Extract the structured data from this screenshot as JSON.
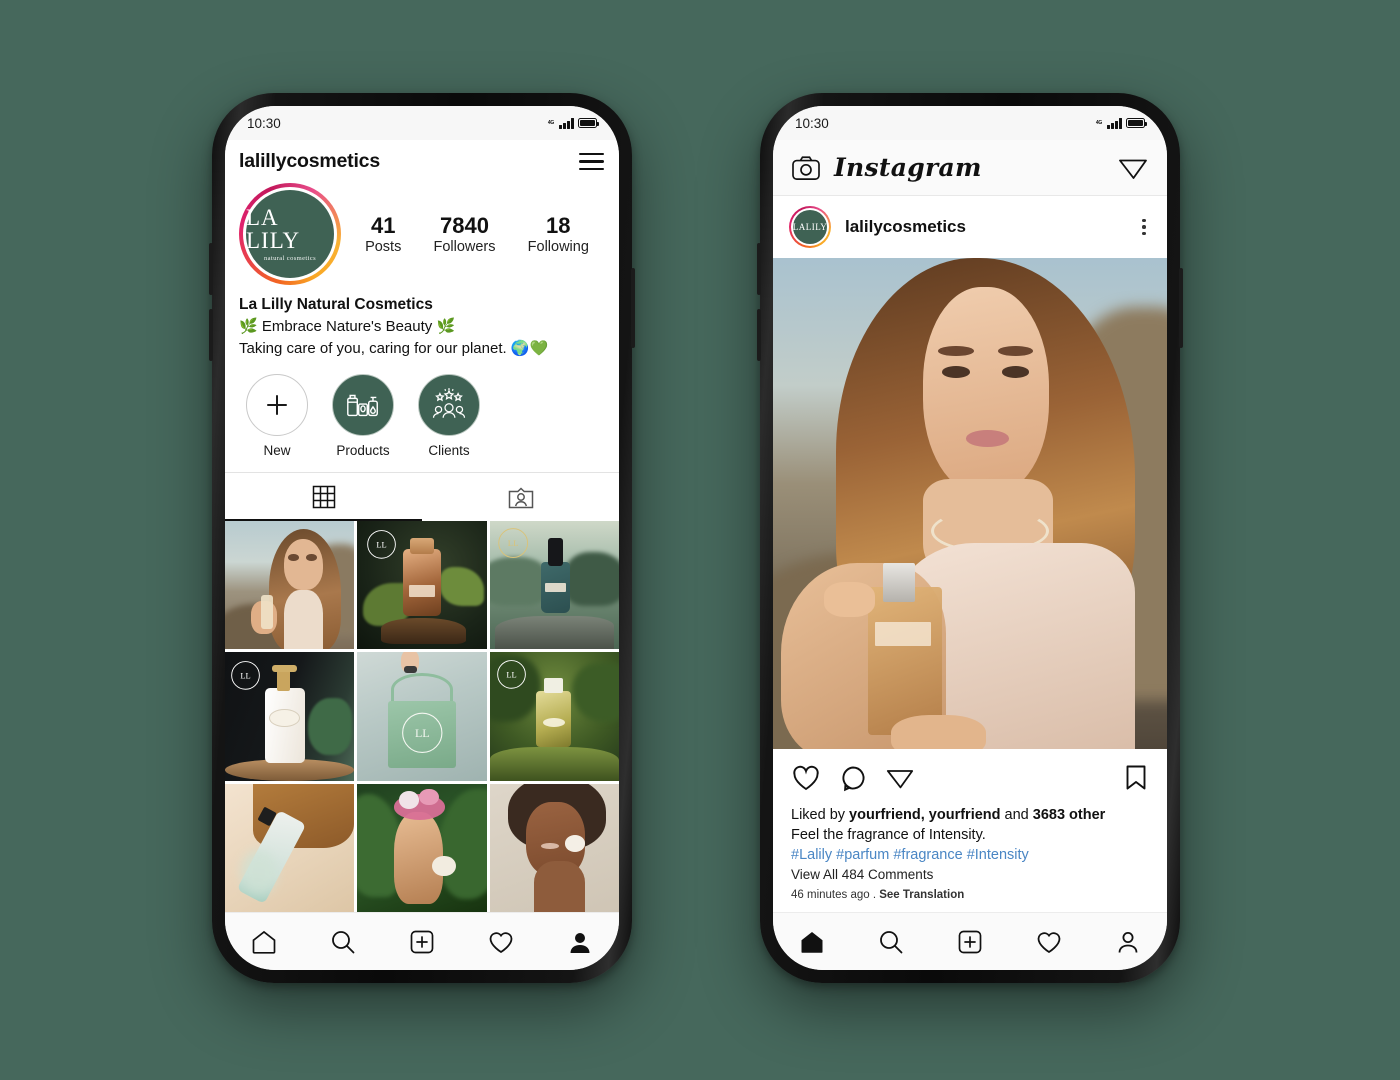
{
  "background_color": "#46685c",
  "brand": {
    "accent_green": "#3f6254",
    "logo_line1": "LA LILY",
    "logo_line2": "natural cosmetics",
    "logo_short": "LALILY"
  },
  "left_phone": {
    "status_bar": {
      "time": "10:30",
      "network": "4G",
      "signal_icon": "signal-bars-icon",
      "battery_icon": "battery-full-icon"
    },
    "header": {
      "handle": "lalillycosmetics",
      "menu_icon": "hamburger-menu-icon"
    },
    "stats": [
      {
        "number": "41",
        "label": "Posts"
      },
      {
        "number": "7840",
        "label": "Followers"
      },
      {
        "number": "18",
        "label": "Following"
      }
    ],
    "bio": {
      "display_name": "La Lilly Natural Cosmetics",
      "line1": "🌿 Embrace Nature's Beauty 🌿",
      "line2": "Taking care of you, caring for our planet. 🌍💚"
    },
    "highlights": [
      {
        "label": "New",
        "icon": "plus-icon",
        "style": "outline"
      },
      {
        "label": "Products",
        "icon": "cosmetic-bottles-icon",
        "style": "filled"
      },
      {
        "label": "Clients",
        "icon": "people-stars-icon",
        "style": "filled"
      }
    ],
    "tabs": [
      {
        "name": "grid",
        "icon": "grid-icon",
        "active": true
      },
      {
        "name": "tagged",
        "icon": "tagged-person-icon",
        "active": false
      }
    ],
    "grid_posts": [
      {
        "alt": "woman holding perfume bottle at sunset cliff",
        "kind": "model-sunset"
      },
      {
        "alt": "amber perfume bottle on wood with foliage",
        "kind": "amber-perfume"
      },
      {
        "alt": "serum dropper bottle on rock by lake",
        "kind": "serum-dropper"
      },
      {
        "alt": "white pump lotion bottle on dark background",
        "kind": "lotion-pump"
      },
      {
        "alt": "green branded tote bag held by hand",
        "kind": "tote-bag"
      },
      {
        "alt": "gold perfume bottle on mossy log in forest",
        "kind": "gold-perfume"
      },
      {
        "alt": "toner bottle on wood slice, beige backdrop",
        "kind": "toner-flatlay"
      },
      {
        "alt": "woman with flower crown in tropical foliage",
        "kind": "flower-crown"
      },
      {
        "alt": "smiling woman applying cotton pad to face",
        "kind": "skincare-smile"
      }
    ],
    "tabbar": [
      {
        "name": "home",
        "icon": "home-icon",
        "active": false
      },
      {
        "name": "search",
        "icon": "search-icon",
        "active": false
      },
      {
        "name": "create",
        "icon": "plus-square-icon",
        "active": false
      },
      {
        "name": "activity",
        "icon": "heart-icon",
        "active": false
      },
      {
        "name": "profile",
        "icon": "person-icon",
        "active": true
      }
    ]
  },
  "right_phone": {
    "status_bar": {
      "time": "10:30",
      "network": "4G",
      "signal_icon": "signal-bars-icon",
      "battery_icon": "battery-full-icon"
    },
    "header": {
      "camera_icon": "camera-icon",
      "wordmark": "Instagram",
      "messages_icon": "paper-plane-icon"
    },
    "post": {
      "username": "lalilycosmetics",
      "more_icon": "more-options-icon",
      "image_alt": "woman holding Intensity by La Lily perfume bottle at golden hour",
      "actions": [
        {
          "name": "like",
          "icon": "heart-icon"
        },
        {
          "name": "comment",
          "icon": "comment-bubble-icon"
        },
        {
          "name": "share",
          "icon": "paper-plane-icon"
        },
        {
          "name": "save",
          "icon": "bookmark-icon"
        }
      ],
      "liked_by_prefix": "Liked by ",
      "liked_by_names": "yourfriend, yourfriend",
      "liked_by_middle": " and ",
      "liked_by_count": "3683 other",
      "caption_text": "Feel the fragrance of Intensity.",
      "hashtags": "#Lalily #parfum #fragrance #Intensity",
      "view_comments": "View All 484 Comments",
      "time_ago": "46 minutes ago",
      "separator": " . ",
      "translate": "See Translation"
    },
    "tabbar": [
      {
        "name": "home",
        "icon": "home-icon",
        "active": true
      },
      {
        "name": "search",
        "icon": "search-icon",
        "active": false
      },
      {
        "name": "create",
        "icon": "plus-square-icon",
        "active": false
      },
      {
        "name": "activity",
        "icon": "heart-icon",
        "active": false
      },
      {
        "name": "profile",
        "icon": "person-icon",
        "active": false
      }
    ]
  }
}
